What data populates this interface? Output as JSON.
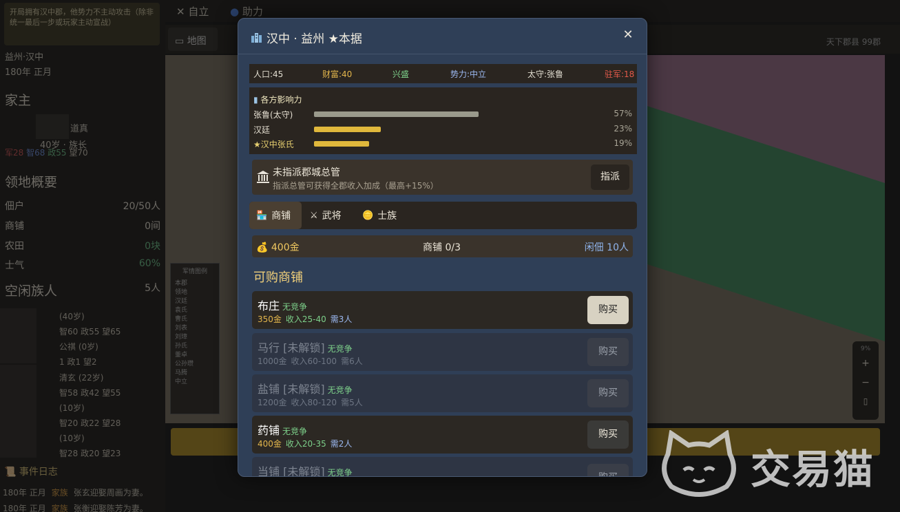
{
  "background": {
    "tip": "开局拥有汉中郡，他势力不主动攻击（除非统一最后一步或玩家主动宣战）",
    "location": "益州·汉中",
    "date": "180年 正月",
    "family_head_label": "家主",
    "head_name": "道真",
    "head_info": "40岁 · 族长",
    "head_stats": {
      "a": "军28",
      "b": "智68",
      "c": "政55",
      "d": "望70"
    },
    "territory_title": "领地概要",
    "territory": [
      {
        "label": "佃户",
        "value": "20/50人"
      },
      {
        "label": "商铺",
        "value": "0间"
      },
      {
        "label": "农田",
        "value": "0块"
      },
      {
        "label": "士气",
        "value": "60%"
      }
    ],
    "idle_title": "空闲族人",
    "idle_count": "5人",
    "members": [
      "(40岁)",
      "智60 政55 望65",
      "公祺 (0岁)",
      "1 政1 望2",
      "清玄 (22岁)",
      "智58 政42 望55",
      "(10岁)",
      "智20 政22 望28",
      "(10岁)",
      "智28 政20 望23"
    ],
    "log_title": "事件日志",
    "logs": [
      {
        "date": "180年 正月",
        "tag": "家族",
        "text": "张玄迎娶周画为妻。"
      },
      {
        "date": "180年 正月",
        "tag": "家族",
        "text": "张衡迎娶陈芳为妻。"
      }
    ],
    "top_buttons": [
      "自立",
      "助力"
    ],
    "map_tab": "地图",
    "region_count": "天下郡县 99郡",
    "legend_title": "军情图例",
    "legend_items": [
      "本郡",
      "领地",
      "汉廷",
      "袁氏",
      "曹氏",
      "刘表",
      "刘璋",
      "孙氏",
      "董卓",
      "公孙瓒",
      "马腾",
      "中立"
    ],
    "zoom_label": "9%",
    "watermark": "交易猫"
  },
  "modal": {
    "title": "汉中 · 益州 ★本据",
    "stats": {
      "population": "人口:45",
      "wealth": "财富:40",
      "prosperity": "兴盛",
      "power": "势力:中立",
      "governor": "太守:张鲁",
      "garrison": "驻军:18"
    },
    "influence_title": "各方影响力",
    "influence": [
      {
        "name": "张鲁(太守)",
        "pct": "57%",
        "value": 0.57,
        "color": "#9a9a8c"
      },
      {
        "name": "汉廷",
        "pct": "23%",
        "value": 0.23,
        "color": "#e0b83c"
      },
      {
        "name": "★汉中张氏",
        "pct": "19%",
        "value": 0.19,
        "color": "#e0b83c"
      }
    ],
    "governor_box": {
      "title": "未指派郡城总管",
      "desc": "指派总管可获得全郡收入加成（最高+15%）",
      "button": "指派"
    },
    "tabs": [
      {
        "icon": "🏪",
        "label": "商铺"
      },
      {
        "icon": "⚔",
        "label": "武将"
      },
      {
        "icon": "🪙",
        "label": "士族"
      }
    ],
    "info": {
      "gold": "💰 400金",
      "shops": "商铺 0/3",
      "idle": "闲佃 10人"
    },
    "section_title": "可购商铺",
    "shops": [
      {
        "name": "布庄",
        "tag": "无竞争",
        "price": "350金",
        "income": "收入25-40",
        "need": "需3人",
        "button": "购买"
      },
      {
        "name": "马行 [未解锁]",
        "tag": "无竞争",
        "price": "1000金",
        "income": "收入60-100",
        "need": "需6人",
        "button": "购买"
      },
      {
        "name": "盐铺 [未解锁]",
        "tag": "无竞争",
        "price": "1200金",
        "income": "收入80-120",
        "need": "需5人",
        "button": "购买"
      },
      {
        "name": "药铺",
        "tag": "无竞争",
        "price": "400金",
        "income": "收入20-35",
        "need": "需2人",
        "button": "购买"
      },
      {
        "name": "当铺 [未解锁]",
        "tag": "无竞争",
        "price": "",
        "income": "",
        "need": "",
        "button": "购买"
      }
    ]
  }
}
